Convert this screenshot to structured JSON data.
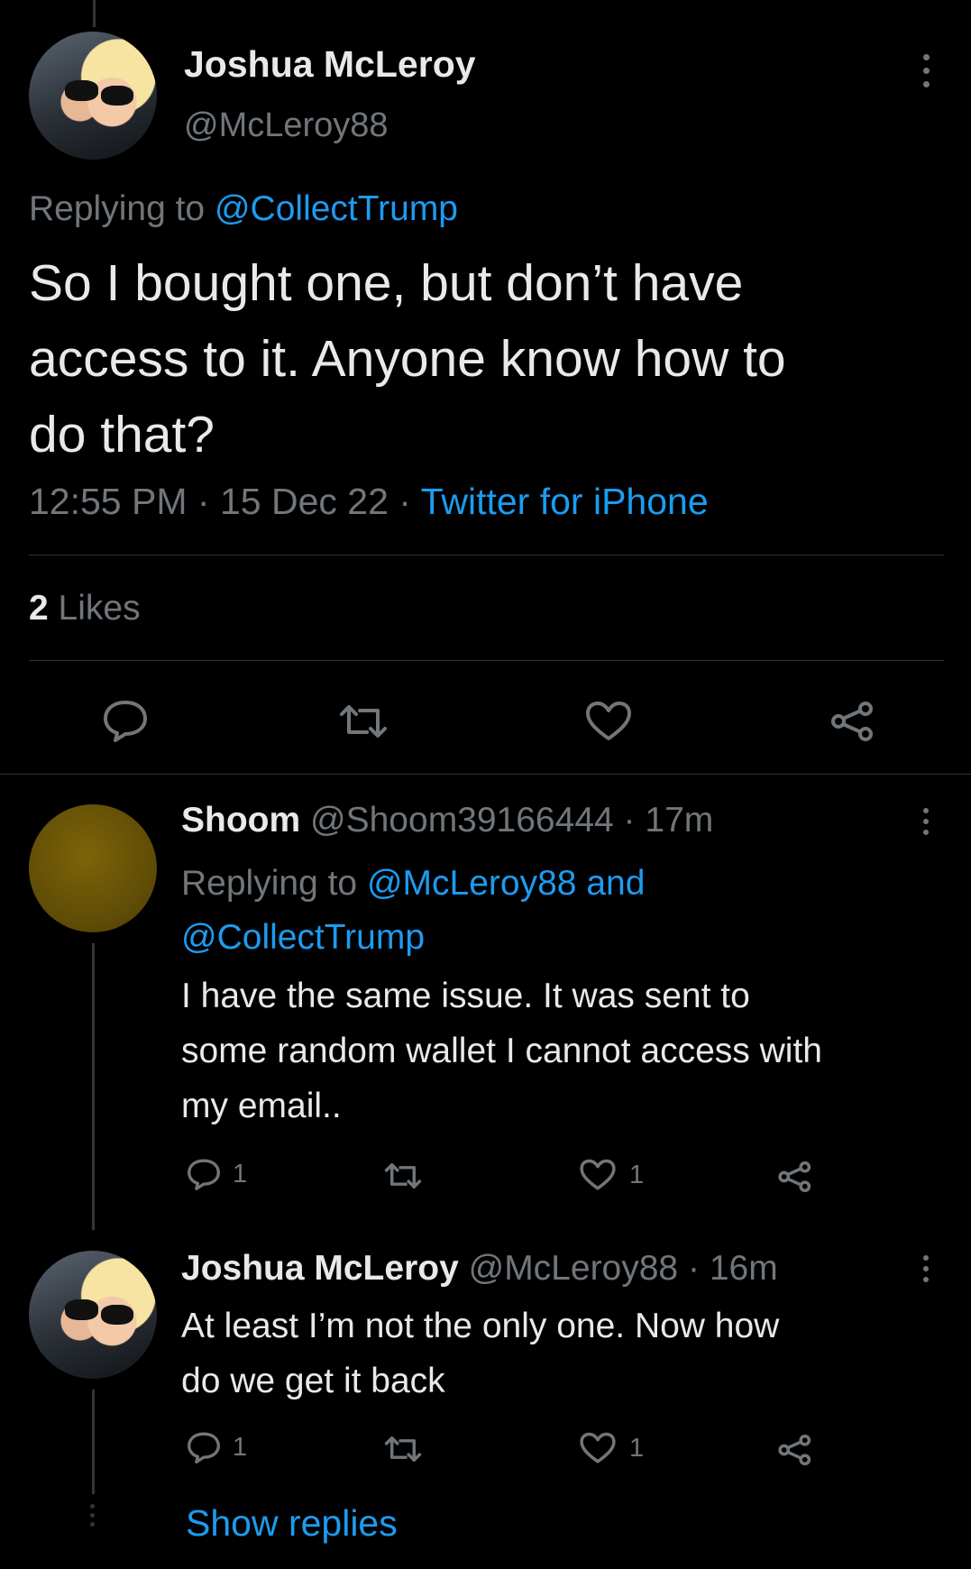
{
  "main_tweet": {
    "author_name": "Joshua McLeroy",
    "handle": "@McLeroy88",
    "replying_prefix": "Replying to",
    "replying_to": "@CollectTrump",
    "text_line1": "So I bought one, but don’t have",
    "text_line2": "access to it. Anyone know how to",
    "text_line3": "do that?",
    "time": "12:55 PM",
    "dot1": "·",
    "date": "15 Dec 22",
    "dot2": "·",
    "source": "Twitter for iPhone",
    "likes_count": "2",
    "likes_label": "Likes"
  },
  "reply1": {
    "author_name": "Shoom",
    "handle": "@Shoom39166444",
    "dot": "·",
    "age": "17m",
    "replying_prefix": "Replying to",
    "replying_to_1": "@McLeroy88 and",
    "replying_to_2": "@CollectTrump",
    "text_line1": "I have the same issue. It was sent to",
    "text_line2": "some random wallet I cannot access with",
    "text_line3": "my email..",
    "reply_count": "1",
    "like_count": "1"
  },
  "reply2": {
    "author_name": "Joshua McLeroy",
    "handle": "@McLeroy88",
    "dot": "·",
    "age": "16m",
    "text_line1": "At least I’m not the only one. Now how",
    "text_line2": "do we get it back",
    "reply_count": "1",
    "like_count": "1"
  },
  "show_replies": "Show replies",
  "icons": [
    "more-icon",
    "reply-icon",
    "retweet-icon",
    "like-icon",
    "share-icon"
  ],
  "colors": {
    "background": "#000000",
    "text": "#e7e9ea",
    "muted": "#71767b",
    "link": "#1d9bf0",
    "divider": "#2f3336"
  }
}
